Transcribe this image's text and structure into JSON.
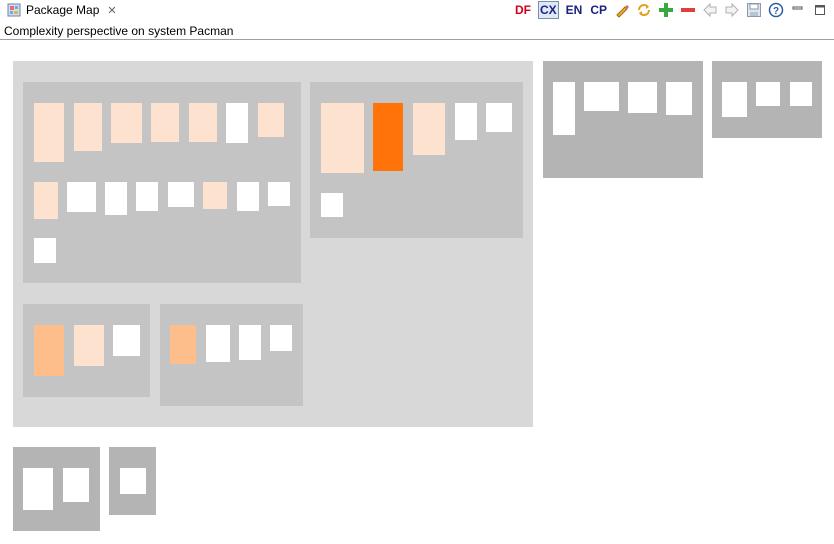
{
  "tab": {
    "title": "Package Map"
  },
  "toolbar": {
    "df": "DF",
    "cx": "CX",
    "en": "EN",
    "cp": "CP",
    "colors": {
      "df": "#d0021b",
      "cx": "#1a237e",
      "en": "#1a237e",
      "cp": "#1a237e"
    }
  },
  "subtitle": "Complexity perspective on system Pacman",
  "legend_colors": {
    "package_outer": "#d8d8d8",
    "package_inner": "#c4c4c4",
    "package_top": "#b4b4b4",
    "class_low": "#ffffff",
    "class_light": "#fde3cf",
    "class_medium": "#fdbe8c",
    "class_high": "#ff7308"
  }
}
